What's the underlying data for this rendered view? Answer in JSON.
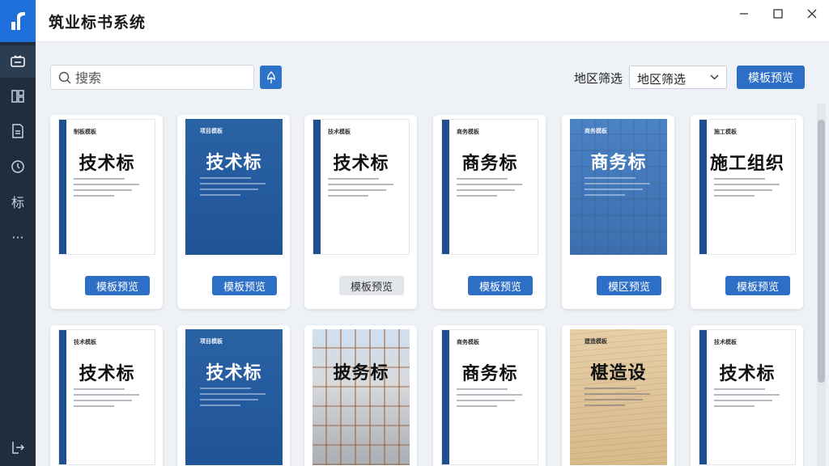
{
  "app": {
    "title": "筑业标书系统"
  },
  "sidebar": {
    "items": [
      {
        "name": "sidebar-item-templates",
        "icon": "template-icon",
        "active": true
      },
      {
        "name": "sidebar-item-projects",
        "icon": "grid-icon"
      },
      {
        "name": "sidebar-item-files",
        "icon": "file-icon"
      },
      {
        "name": "sidebar-item-history",
        "icon": "clock-icon"
      },
      {
        "name": "sidebar-item-bid",
        "icon": "bid-text-icon",
        "label": "标"
      },
      {
        "name": "sidebar-item-more",
        "icon": "more-icon",
        "label": "···"
      },
      {
        "name": "sidebar-item-logout",
        "icon": "logout-icon"
      }
    ]
  },
  "toolbar": {
    "search_placeholder": "搜索",
    "region_label": "地区筛选",
    "region_value": "地区筛选",
    "preview_label": "模板预览"
  },
  "cards": [
    {
      "title": "技术标",
      "header": "制板模板",
      "button": "模板预览",
      "style": "white"
    },
    {
      "title": "技术标",
      "header": "项目模板",
      "button": "模板预览",
      "style": "blue"
    },
    {
      "title": "技术标",
      "header": "技术模板",
      "button": "模板预览",
      "style": "white",
      "disabled": true
    },
    {
      "title": "商务标",
      "header": "商务模板",
      "button": "模板预览",
      "style": "white"
    },
    {
      "title": "商务标",
      "header": "商务模板",
      "button": "模区预览",
      "style": "photo-tinted"
    },
    {
      "title": "施工组织",
      "header": "施工模板",
      "button": "模板预览",
      "style": "white"
    },
    {
      "title": "技术标",
      "header": "技术模板",
      "style": "white"
    },
    {
      "title": "技术标",
      "header": "项目模板",
      "style": "blue"
    },
    {
      "title": "披务标",
      "header": "",
      "style": "scaffold"
    },
    {
      "title": "商务标",
      "header": "商务模板",
      "style": "white"
    },
    {
      "title": "椹造设",
      "header": "建造模板",
      "style": "wood"
    },
    {
      "title": "技术标",
      "header": "技术模板",
      "style": "white"
    }
  ],
  "colors": {
    "accent": "#2d6ec7",
    "sidebar": "#1f2d3d",
    "logo": "#1e6fd9"
  }
}
